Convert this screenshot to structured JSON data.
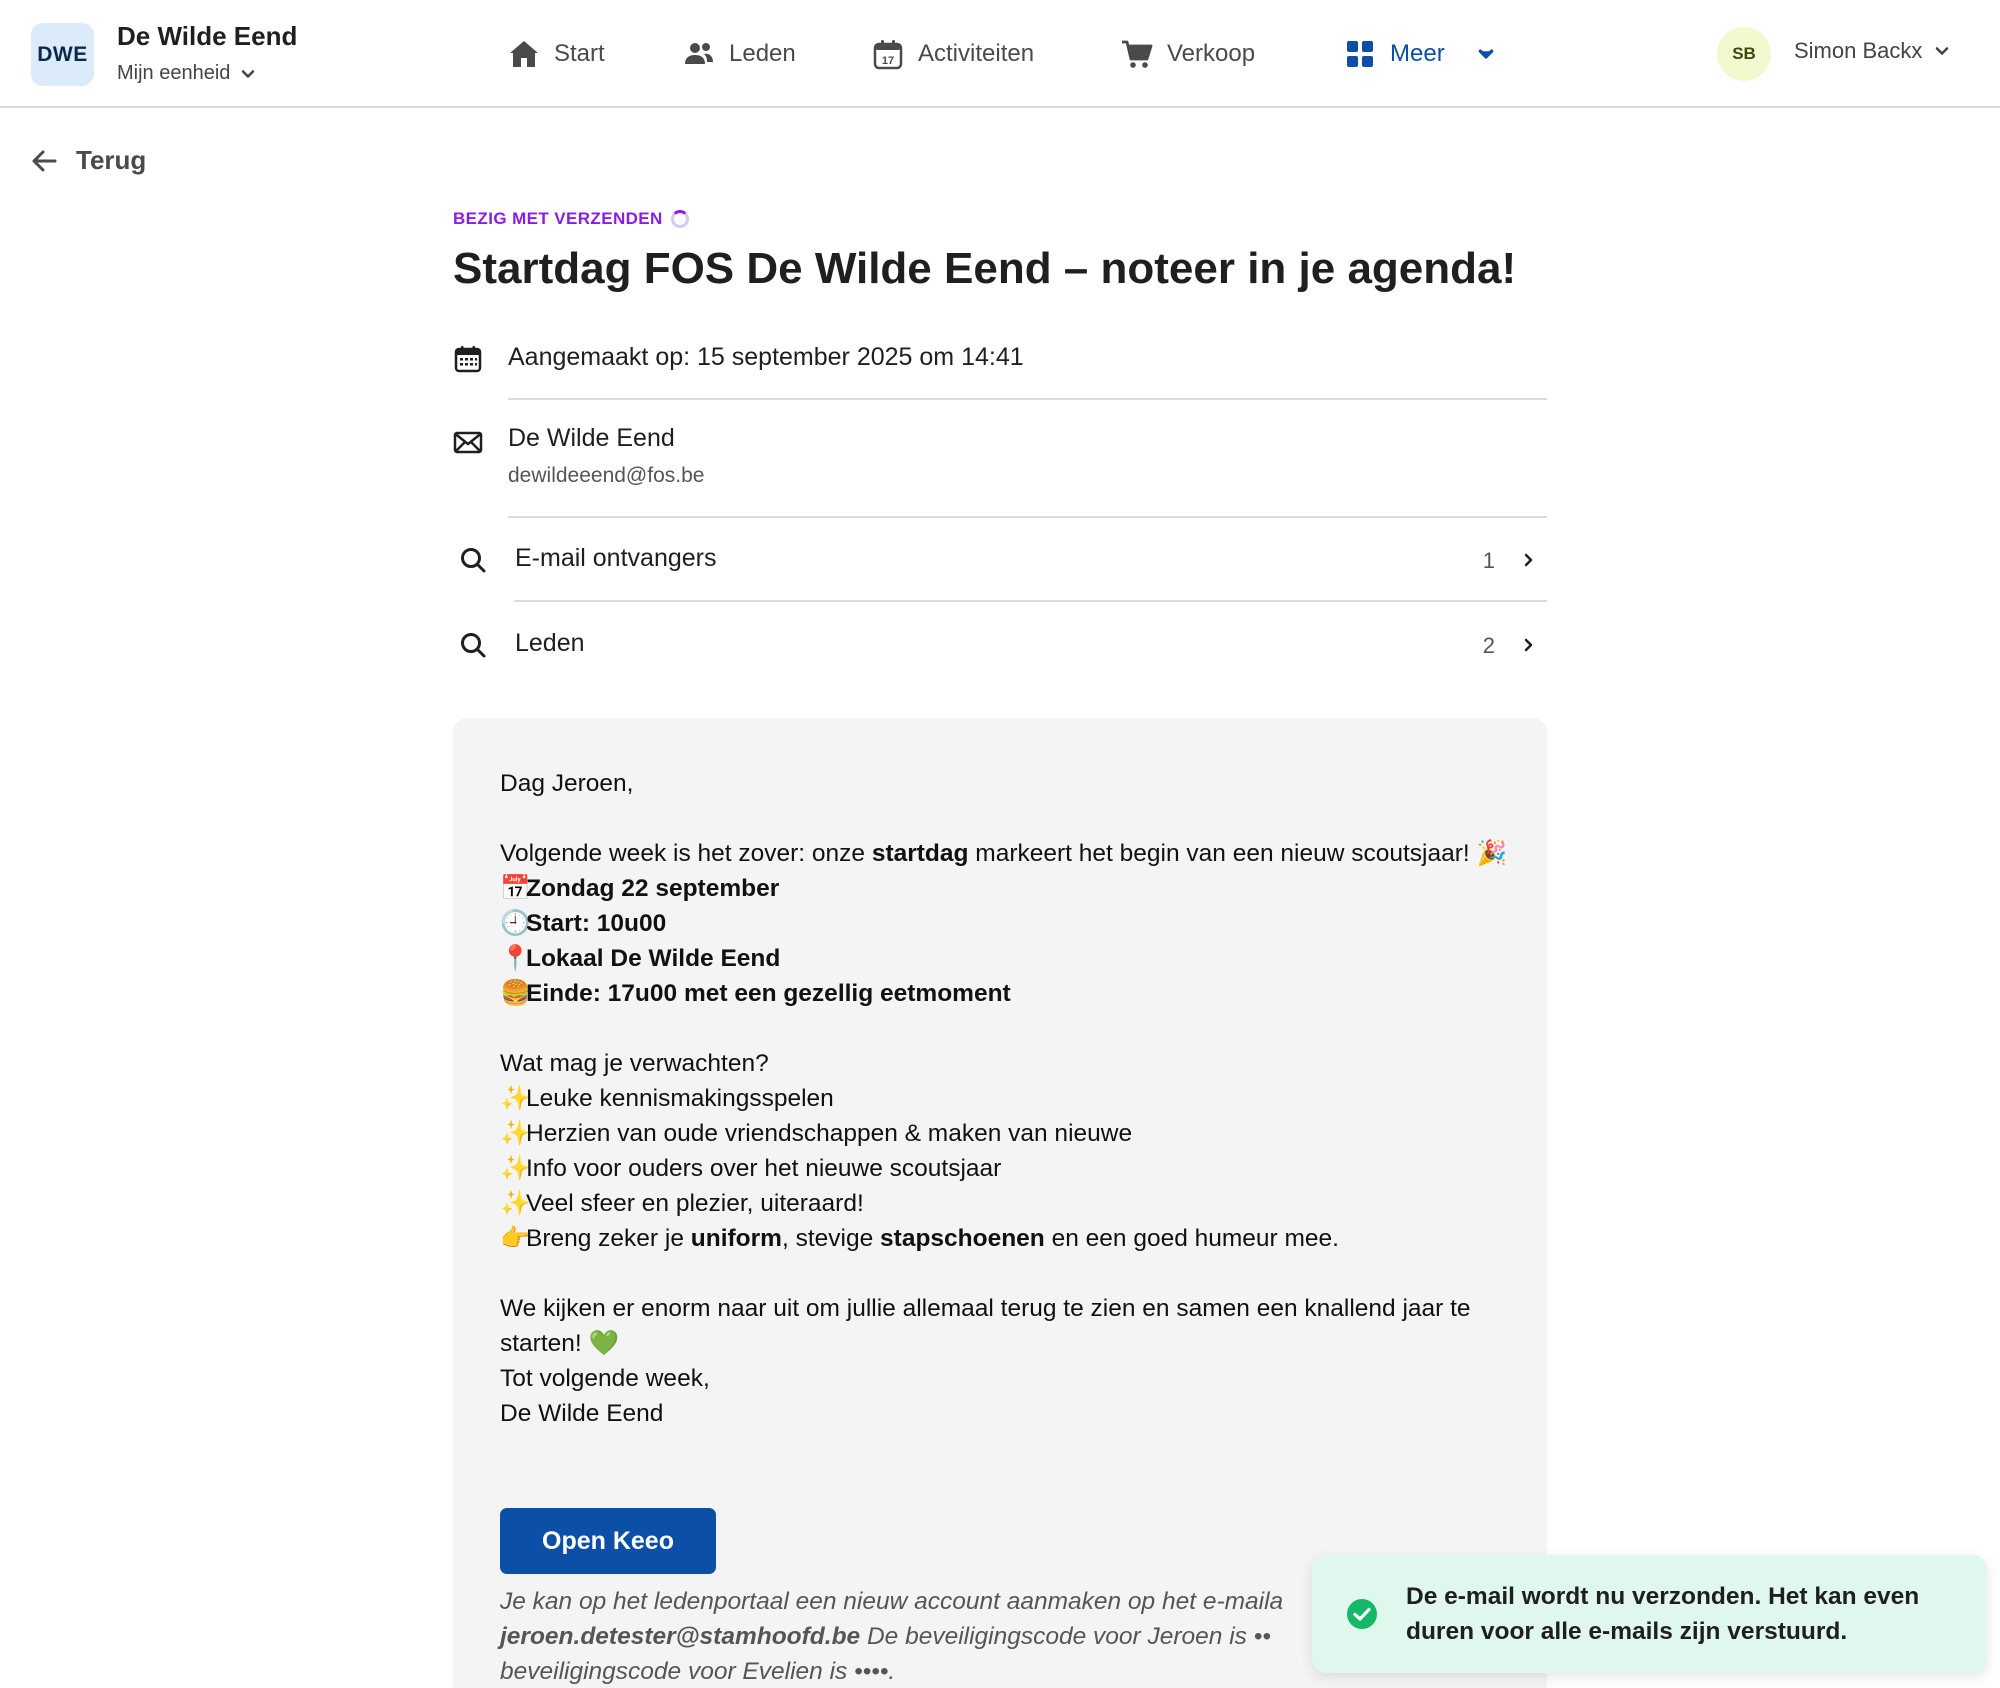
{
  "header": {
    "org_logo": "DWE",
    "org_name": "De Wilde Eend",
    "org_sub": "Mijn eenheid",
    "nav": [
      {
        "label": "Start",
        "icon": "home-icon"
      },
      {
        "label": "Leden",
        "icon": "users-icon"
      },
      {
        "label": "Activiteiten",
        "icon": "calendar-icon"
      },
      {
        "label": "Verkoop",
        "icon": "cart-icon"
      },
      {
        "label": "Meer",
        "icon": "grid-icon",
        "active": true
      }
    ],
    "user_initials": "SB",
    "user_name": "Simon Backx"
  },
  "back_label": "Terug",
  "email": {
    "status": "BEZIG MET VERZENDEN",
    "title": "Startdag FOS De Wilde Eend – noteer in je agenda!",
    "created": "Aangemaakt op: 15 september 2025 om 14:41",
    "sender_name": "De Wilde Eend",
    "sender_email": "dewildeeend@fos.be",
    "recipients": [
      {
        "label": "E-mail ontvangers",
        "count": "1"
      },
      {
        "label": "Leden",
        "count": "2"
      }
    ]
  },
  "preview": {
    "greeting": "Dag Jeroen,",
    "intro_1": "Volgende week is het zover: onze ",
    "intro_bold": "startdag",
    "intro_2": " markeert het begin van een nieuw scoutsjaar! ",
    "emoji_party": "🎉",
    "details": [
      {
        "emoji": "📅",
        "text": "Zondag 22 september"
      },
      {
        "emoji": "🕘",
        "text": "Start: 10u00"
      },
      {
        "emoji": "📍",
        "text": "Lokaal De Wilde Eend"
      },
      {
        "emoji": "🍔",
        "text": "Einde: 17u00 met een gezellig eetmoment"
      }
    ],
    "expect_title": "Wat mag je verwachten?",
    "expect": [
      {
        "emoji": "✨",
        "text": "Leuke kennismakingsspelen"
      },
      {
        "emoji": "✨",
        "text": "Herzien van oude vriendschappen & maken van nieuwe"
      },
      {
        "emoji": "✨",
        "text": "Info voor ouders over het nieuwe scoutsjaar"
      },
      {
        "emoji": "✨",
        "text": "Veel sfeer en plezier, uiteraard!"
      }
    ],
    "bring_emoji": "👉",
    "bring_1": "Breng zeker je ",
    "bring_b1": "uniform",
    "bring_2": ", stevige ",
    "bring_b2": "stapschoenen",
    "bring_3": " en een goed humeur mee.",
    "outro": "We kijken er enorm naar uit om jullie allemaal terug te zien en samen een knallend jaar te starten! ",
    "emoji_heart": "💚",
    "closing": "Tot volgende week,",
    "signature": "De Wilde Eend",
    "button": "Open Keeo",
    "note_1": "Je kan op het ledenportaal een nieuw account aanmaken op het e-maila",
    "note_email": "jeroen.detester@stamhoofd.be",
    "note_2": " De beveiligingscode voor Jeroen is ••",
    "note_3": "beveiligingscode voor Evelien is ••••."
  },
  "toast": {
    "message": "De e-mail wordt nu verzonden. Het kan even duren voor alle e-mails zijn verstuurd."
  },
  "colors": {
    "accent": "#0b4fa6",
    "status": "#8a1ee0",
    "toast_bg": "#dff7ec",
    "success": "#14b866"
  }
}
